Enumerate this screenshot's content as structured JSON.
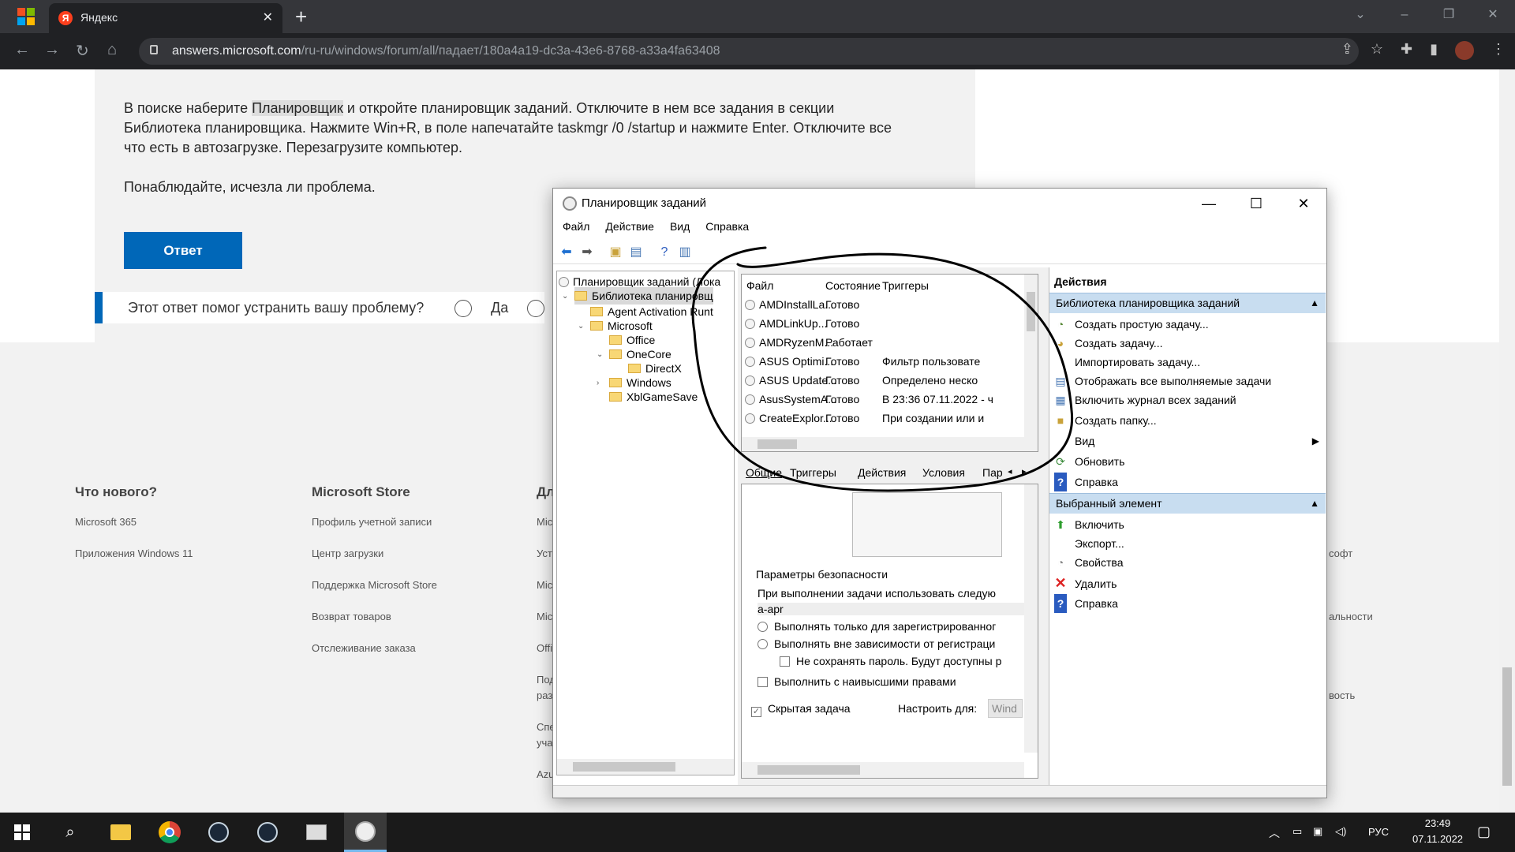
{
  "browser": {
    "tab_title": "Яндекс",
    "tab_close": "✕",
    "new_tab": "+",
    "url_host": "answers.microsoft.com",
    "url_path": "/ru-ru/windows/forum/all/падает/180a4a19-dc3a-43e6-8768-a33a4fa63408",
    "controls": [
      "⌄",
      "–",
      "❐",
      "✕"
    ]
  },
  "post": {
    "line1_before": "В поиске наберите ",
    "line1_highlight": "Планировщик",
    "line1_after": " и откройте планировщик заданий. Отключите в нем все задания в секции",
    "line2": "Библиотека планировщика. Нажмите Win+R, в поле напечатайте taskmgr /0 /startup и нажмите Enter. Отключите все",
    "line3": "что есть в автозагрузке. Перезагрузите компьютер.",
    "line4": "Понаблюдайте, исчезла ли проблема.",
    "answer_button": "Ответ",
    "helpful_question": "Этот ответ помог устранить вашу проблему?",
    "yes_label": "Да"
  },
  "footer": {
    "columns": [
      {
        "heading": "Что нового?",
        "links": [
          "Microsoft 365",
          "Приложения Windows 11"
        ]
      },
      {
        "heading": "Microsoft Store",
        "links": [
          "Профиль учетной записи",
          "Центр загрузки",
          "Поддержка Microsoft Store",
          "Возврат товаров",
          "Отслеживание заказа"
        ]
      },
      {
        "heading": "Дл",
        "links": [
          "Mic",
          "Уст",
          "Mic",
          "Mic",
          "Offi",
          "Под",
          "раз",
          "Спе",
          "уча",
          "Azu"
        ]
      }
    ],
    "right_fragments": [
      "софт",
      "альности",
      "вость"
    ]
  },
  "scheduler": {
    "title": "Планировщик заданий",
    "window_controls": [
      "—",
      "☐",
      "✕"
    ],
    "menu": [
      "Файл",
      "Действие",
      "Вид",
      "Справка"
    ],
    "tree": [
      "Планировщик заданий (Лока",
      "Библиотека планировщ",
      "Agent Activation Runt",
      "Microsoft",
      "Office",
      "OneCore",
      "DirectX",
      "Windows",
      "XblGameSave"
    ],
    "columns": [
      "Файл",
      "Состояние",
      "Триггеры"
    ],
    "tasks": [
      {
        "name": "AMDInstallLa...",
        "state": "Готово",
        "trigger": ""
      },
      {
        "name": "AMDLinkUp...",
        "state": "Готово",
        "trigger": ""
      },
      {
        "name": "AMDRyzenM...",
        "state": "Работает",
        "trigger": ""
      },
      {
        "name": "ASUS Optimi...",
        "state": "Готово",
        "trigger": "Фильтр пользовате"
      },
      {
        "name": "ASUS Update...",
        "state": "Готово",
        "trigger": "Определено неско"
      },
      {
        "name": "AsusSystemA...",
        "state": "Готово",
        "trigger": "В 23:36 07.11.2022 - ч"
      },
      {
        "name": "CreateExplor...",
        "state": "Готово",
        "trigger": "При создании или и"
      }
    ],
    "detail_tabs": [
      "Общие",
      "Триггеры",
      "Действия",
      "Условия",
      "Пар"
    ],
    "security_title": "Параметры безопасности",
    "security_account_label": "При выполнении задачи использовать следую",
    "security_account": "a-apr",
    "radio_registered": "Выполнять только для зарегистрированног",
    "radio_any": "Выполнять вне зависимости от регистраци",
    "chk_no_password": "Не сохранять пароль. Будут доступны р",
    "chk_highest": "Выполнить с наивысшими правами",
    "chk_hidden": "Скрытая задача",
    "configure_for": "Настроить для:",
    "configure_value": "Wind",
    "actions_title": "Действия",
    "section_library": "Библиотека планировщика заданий",
    "library_actions": [
      {
        "label": "Создать простую задачу...",
        "icon": "create-basic-task-icon"
      },
      {
        "label": "Создать задачу...",
        "icon": "create-task-icon"
      },
      {
        "label": "Импортировать задачу...",
        "icon": ""
      },
      {
        "label": "Отображать все выполняемые задачи",
        "icon": "running-tasks-icon"
      },
      {
        "label": "Включить журнал всех заданий",
        "icon": "history-icon"
      },
      {
        "label": "Создать папку...",
        "icon": "new-folder-icon"
      },
      {
        "label": "Вид",
        "icon": ""
      },
      {
        "label": "Обновить",
        "icon": "refresh-icon"
      },
      {
        "label": "Справка",
        "icon": "help-icon"
      }
    ],
    "section_selected": "Выбранный элемент",
    "selected_actions": [
      {
        "label": "Включить",
        "icon": "enable-arrow-icon"
      },
      {
        "label": "Экспорт...",
        "icon": ""
      },
      {
        "label": "Свойства",
        "icon": "properties-icon"
      },
      {
        "label": "Удалить",
        "icon": "delete-icon"
      },
      {
        "label": "Справка",
        "icon": "help-icon"
      }
    ]
  },
  "taskbar": {
    "language": "РУС",
    "time": "23:49",
    "date": "07.11.2022"
  },
  "colors": {
    "accent_blue": "#0067b8",
    "selected_section": "#c8ddf0",
    "annotation_ink": "#000000"
  }
}
